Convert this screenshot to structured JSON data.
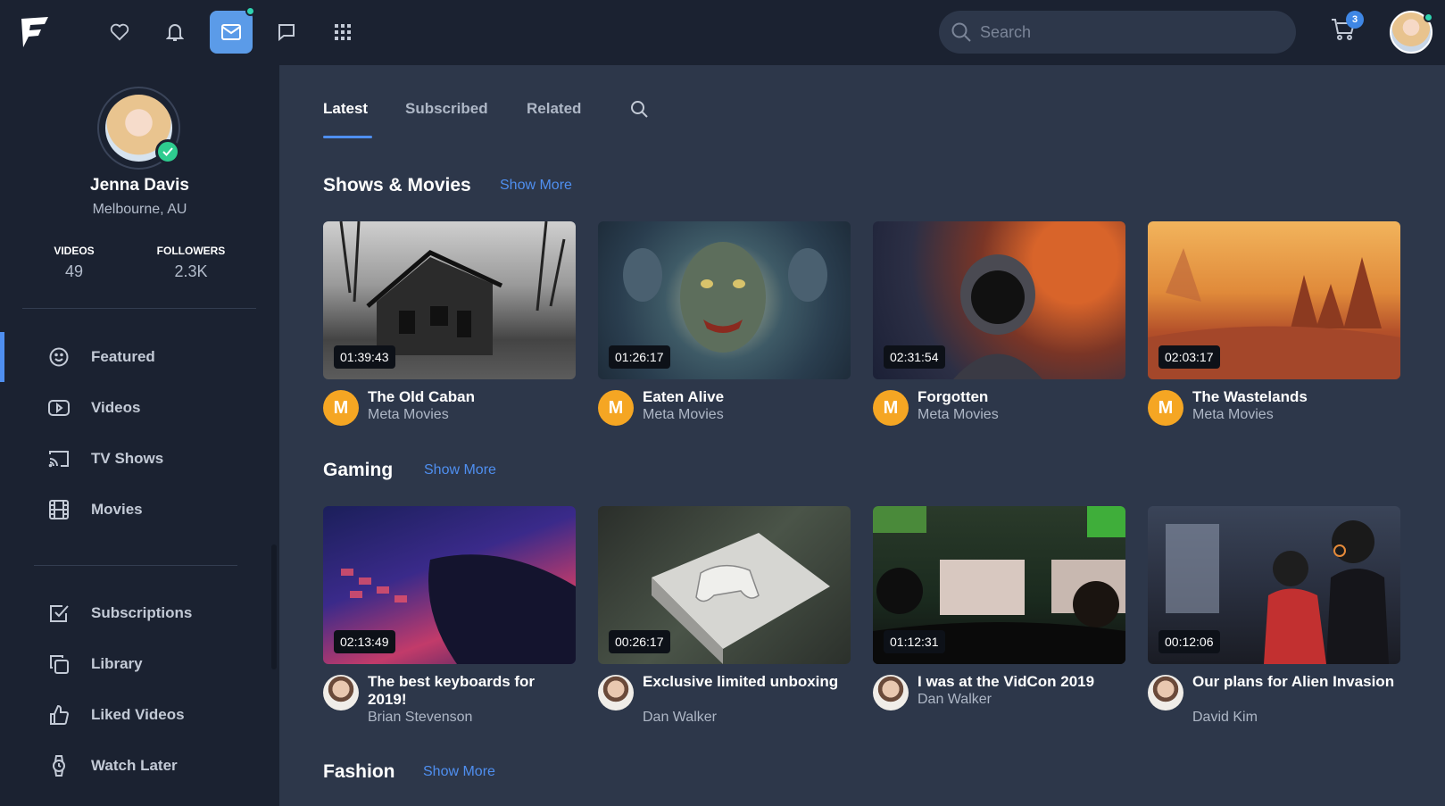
{
  "header": {
    "search_placeholder": "Search",
    "cart_badge": "3"
  },
  "profile": {
    "name": "Jenna Davis",
    "location": "Melbourne, AU",
    "stats": [
      {
        "label": "VIDEOS",
        "value": "49"
      },
      {
        "label": "FOLLOWERS",
        "value": "2.3K"
      }
    ]
  },
  "sidebar": {
    "menu_primary": [
      {
        "label": "Featured",
        "icon": "smile-icon",
        "active": true
      },
      {
        "label": "Videos",
        "icon": "play-icon"
      },
      {
        "label": "TV Shows",
        "icon": "cast-icon"
      },
      {
        "label": "Movies",
        "icon": "film-icon"
      }
    ],
    "menu_secondary": [
      {
        "label": "Subscriptions",
        "icon": "check-square-icon"
      },
      {
        "label": "Library",
        "icon": "copy-icon"
      },
      {
        "label": "Liked Videos",
        "icon": "thumbs-up-icon"
      },
      {
        "label": "Watch Later",
        "icon": "watch-icon"
      }
    ]
  },
  "tabs": [
    "Latest",
    "Subscribed",
    "Related"
  ],
  "sections": [
    {
      "title": "Shows & Movies",
      "show_more": "Show More",
      "videos": [
        {
          "title": "The Old Caban",
          "channel": "Meta Movies",
          "duration": "01:39:43"
        },
        {
          "title": "Eaten Alive",
          "channel": "Meta Movies",
          "duration": "01:26:17"
        },
        {
          "title": "Forgotten",
          "channel": "Meta Movies",
          "duration": "02:31:54"
        },
        {
          "title": "The Wastelands",
          "channel": "Meta Movies",
          "duration": "02:03:17"
        }
      ]
    },
    {
      "title": "Gaming",
      "show_more": "Show More",
      "videos": [
        {
          "title": "The best keyboards for 2019!",
          "channel": "Brian Stevenson",
          "duration": "02:13:49"
        },
        {
          "title": "Exclusive limited unboxing",
          "channel": "Dan Walker",
          "duration": "00:26:17"
        },
        {
          "title": "I was at the VidCon 2019",
          "channel": "Dan Walker",
          "duration": "01:12:31"
        },
        {
          "title": "Our plans for Alien Invasion",
          "channel": "David Kim",
          "duration": "00:12:06"
        }
      ]
    },
    {
      "title": "Fashion",
      "show_more": "Show More",
      "videos": []
    }
  ],
  "channel_avatar_letter": "M",
  "colors": {
    "accent": "#4f8ff0",
    "topbar_bg": "#1b2231",
    "content_bg": "#2d374a",
    "channel_avatar": "#f5a623",
    "online_dot": "#2fd3b0"
  }
}
